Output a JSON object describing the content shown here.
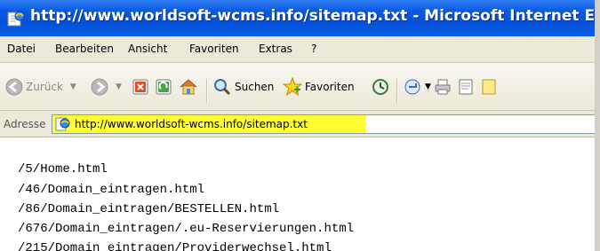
{
  "window": {
    "title": "http://www.worldsoft-wcms.info/sitemap.txt - Microsoft Internet Explorer"
  },
  "menu": {
    "items": [
      "Datei",
      "Bearbeiten",
      "Ansicht",
      "Favoriten",
      "Extras",
      "?"
    ]
  },
  "toolbar": {
    "back_label": "Zurück",
    "search_label": "Suchen",
    "favorites_label": "Favoriten"
  },
  "address": {
    "label": "Adresse",
    "url": "http://www.worldsoft-wcms.info/sitemap.txt",
    "highlight_color": "#ffff33"
  },
  "content": {
    "lines": [
      "/5/Home.html",
      "/46/Domain_eintragen.html",
      "/86/Domain_eintragen/BESTELLEN.html",
      "/676/Domain_eintragen/.eu-Reservierungen.html",
      "/215/Domain_eintragen/Providerwechsel.html"
    ]
  },
  "colors": {
    "titlebar": "#0550d8",
    "chrome": "#ece9d8"
  }
}
